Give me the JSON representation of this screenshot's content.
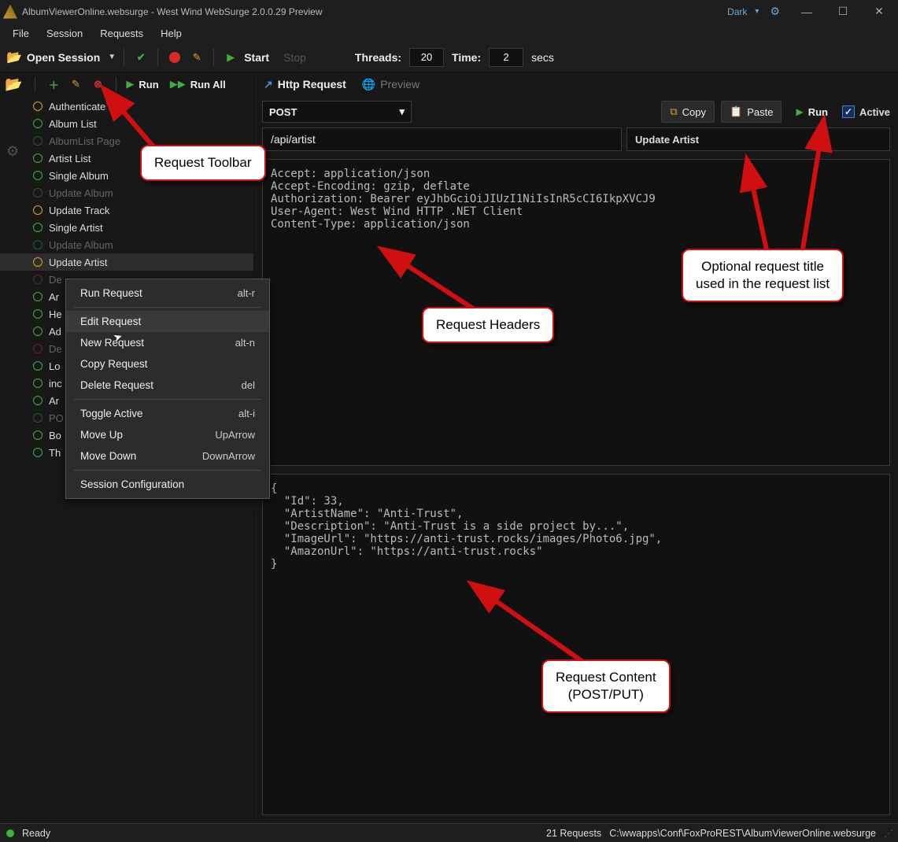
{
  "titlebar": {
    "title": "AlbumViewerOnline.websurge - West Wind WebSurge 2.0.0.29 Preview",
    "theme": "Dark"
  },
  "menu": [
    "File",
    "Session",
    "Requests",
    "Help"
  ],
  "toolbar": {
    "open_session": "Open Session",
    "start": "Start",
    "stop": "Stop",
    "threads_label": "Threads:",
    "threads_value": "20",
    "time_label": "Time:",
    "time_value": "2",
    "time_unit": "secs"
  },
  "req_toolbar": {
    "run": "Run",
    "run_all": "Run All"
  },
  "sidebar": [
    {
      "label": "Authenticate",
      "dot": "orange",
      "dim": false
    },
    {
      "label": "Album List",
      "dot": "green",
      "dim": false
    },
    {
      "label": "AlbumList Page",
      "dot": "green",
      "dim": true
    },
    {
      "label": "Artist List",
      "dot": "green",
      "dim": false
    },
    {
      "label": "Single Album",
      "dot": "green",
      "dim": false
    },
    {
      "label": "Update Album",
      "dot": "green",
      "dim": true
    },
    {
      "label": "Update Track",
      "dot": "orange",
      "dim": false
    },
    {
      "label": "Single Artist",
      "dot": "green",
      "dim": false
    },
    {
      "label": "Update Album",
      "dot": "green",
      "dim": true
    },
    {
      "label": "Update Artist",
      "dot": "orange",
      "dim": false,
      "selected": true
    },
    {
      "label": "De",
      "dot": "red",
      "dim": true
    },
    {
      "label": "Ar",
      "dot": "green",
      "dim": false
    },
    {
      "label": "He",
      "dot": "green",
      "dim": false
    },
    {
      "label": "Ad",
      "dot": "green",
      "dim": false
    },
    {
      "label": "De",
      "dot": "red",
      "dim": true
    },
    {
      "label": "Lo",
      "dot": "green",
      "dim": false
    },
    {
      "label": "inc",
      "dot": "green",
      "dim": false
    },
    {
      "label": "Ar",
      "dot": "green",
      "dim": false
    },
    {
      "label": "PO",
      "dot": "green",
      "dim": true
    },
    {
      "label": "Bo",
      "dot": "green",
      "dim": false
    },
    {
      "label": "Th",
      "dot": "green",
      "dim": false
    }
  ],
  "context_menu": [
    {
      "label": "Run Request",
      "shortcut": "alt-r"
    },
    {
      "sep": true
    },
    {
      "label": "Edit Request",
      "hover": true
    },
    {
      "label": "New Request",
      "shortcut": "alt-n"
    },
    {
      "label": "Copy Request"
    },
    {
      "label": "Delete Request",
      "shortcut": "del"
    },
    {
      "sep": true
    },
    {
      "label": "Toggle Active",
      "shortcut": "alt-i"
    },
    {
      "label": "Move Up",
      "shortcut": "UpArrow"
    },
    {
      "label": "Move Down",
      "shortcut": "DownArrow"
    },
    {
      "sep": true
    },
    {
      "label": "Session Configuration"
    }
  ],
  "tabs": {
    "http_request": "Http Request",
    "preview": "Preview"
  },
  "request": {
    "method": "POST",
    "copy": "Copy",
    "paste": "Paste",
    "run": "Run",
    "active": "Active",
    "url": "/api/artist",
    "title": "Update Artist",
    "headers": "Accept: application/json\nAccept-Encoding: gzip, deflate\nAuthorization: Bearer eyJhbGciOiJIUzI1NiIsInR5cCI6IkpXVCJ9\nUser-Agent: West Wind HTTP .NET Client\nContent-Type: application/json",
    "body": "{\n  \"Id\": 33,\n  \"ArtistName\": \"Anti-Trust\",\n  \"Description\": \"Anti-Trust is a side project by...\",\n  \"ImageUrl\": \"https://anti-trust.rocks/images/Photo6.jpg\",\n  \"AmazonUrl\": \"https://anti-trust.rocks\"\n}"
  },
  "status": {
    "ready": "Ready",
    "count": "21 Requests",
    "path": "C:\\wwapps\\Conf\\FoxProREST\\AlbumViewerOnline.websurge"
  },
  "callouts": {
    "toolbar": "Request Toolbar",
    "headers": "Request Headers",
    "title": "Optional request title\nused in the request list",
    "content": "Request Content\n(POST/PUT)"
  }
}
